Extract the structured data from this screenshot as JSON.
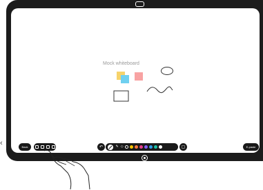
{
  "whiteboard": {
    "title": "Mock whiteboard"
  },
  "toolbar": {
    "left_label": "Back",
    "right_label": "E-paste",
    "undo_icon": "undo-icon",
    "redo_icon": "redo-icon",
    "pen_icon": "pen-icon",
    "highlighter_icon": "highlighter-icon",
    "eraser_icon": "eraser-icon",
    "colors": [
      "#111111",
      "#f5c400",
      "#ff7a3d",
      "#e83e8c",
      "#8a5cf6",
      "#2f9ee8",
      "#19c3a6",
      "#ffffff"
    ]
  },
  "stickies": {
    "colors": [
      "#f6d36b",
      "#6fd0f0",
      "#f8a3a3"
    ]
  },
  "icons": {
    "camera": "camera-icon",
    "home": "home-icon",
    "back": "chevron-left-icon"
  }
}
